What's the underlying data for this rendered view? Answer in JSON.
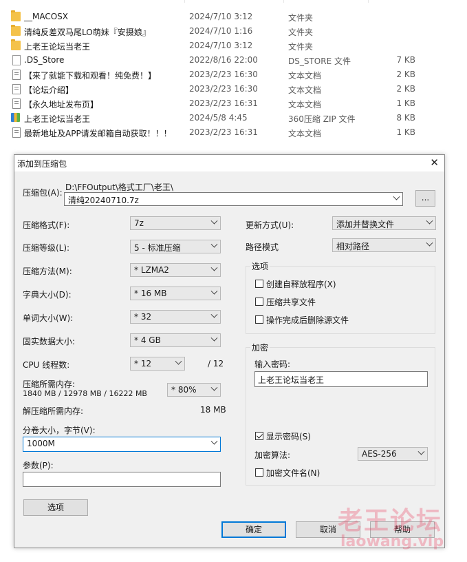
{
  "files": [
    {
      "name": "__MACOSX",
      "date": "2024/7/10 3:12",
      "type": "文件夹",
      "size": "",
      "icon": "folder-icon"
    },
    {
      "name": "清纯反差双马尾LO萌妹『安摄娘』",
      "date": "2024/7/10 1:16",
      "type": "文件夹",
      "size": "",
      "icon": "folder-icon"
    },
    {
      "name": "上老王论坛当老王",
      "date": "2024/7/10 3:12",
      "type": "文件夹",
      "size": "",
      "icon": "folder-icon"
    },
    {
      "name": ".DS_Store",
      "date": "2022/8/16 22:00",
      "type": "DS_STORE 文件",
      "size": "7 KB",
      "icon": "file-icon"
    },
    {
      "name": "【来了就能下载和观看！纯免费！】",
      "date": "2023/2/23 16:30",
      "type": "文本文档",
      "size": "2 KB",
      "icon": "text-file-icon"
    },
    {
      "name": "【论坛介绍】",
      "date": "2023/2/23 16:30",
      "type": "文本文档",
      "size": "2 KB",
      "icon": "text-file-icon"
    },
    {
      "name": "【永久地址发布页】",
      "date": "2023/2/23 16:31",
      "type": "文本文档",
      "size": "1 KB",
      "icon": "text-file-icon"
    },
    {
      "name": "上老王论坛当老王",
      "date": "2024/5/8 4:45",
      "type": "360压缩 ZIP 文件",
      "size": "8 KB",
      "icon": "zip-icon"
    },
    {
      "name": "最新地址及APP请发邮箱自动获取！！！",
      "date": "2023/2/23 16:31",
      "type": "文本文档",
      "size": "1 KB",
      "icon": "text-file-icon"
    }
  ],
  "dialog": {
    "title": "添加到压缩包",
    "archive_label": "压缩包(A):",
    "archive_path": "D:\\FFOutput\\格式工厂\\老王\\",
    "archive_name": "清纯20240710.7z",
    "browse_label": "...",
    "format_label": "压缩格式(F):",
    "format_value": "7z",
    "level_label": "压缩等级(L):",
    "level_value": "5 - 标准压缩",
    "method_label": "压缩方法(M):",
    "method_value": "* LZMA2",
    "dict_label": "字典大小(D):",
    "dict_value": "* 16 MB",
    "word_label": "单词大小(W):",
    "word_value": "* 32",
    "solid_label": "固实数据大小:",
    "solid_value": "* 4 GB",
    "threads_label": "CPU 线程数:",
    "threads_value": "* 12",
    "threads_max": "/ 12",
    "mem_label": "压缩所需内存:",
    "mem_detail": "1840 MB / 12978 MB / 16222 MB",
    "mem_percent": "* 80%",
    "decomp_label": "解压缩所需内存:",
    "decomp_value": "18 MB",
    "split_label": "分卷大小，字节(V):",
    "split_value": "1000M",
    "params_label": "参数(P):",
    "params_value": "",
    "options_button": "选项",
    "update_label": "更新方式(U):",
    "update_value": "添加并替换文件",
    "path_label": "路径模式",
    "path_value": "相对路径",
    "options_group": "选项",
    "opt_sfx": "创建自释放程序(X)",
    "opt_shared": "压缩共享文件",
    "opt_delete": "操作完成后删除源文件",
    "encrypt_group": "加密",
    "password_label": "输入密码:",
    "password_value": "上老王论坛当老王",
    "show_password": "显示密码(S)",
    "enc_method_label": "加密算法:",
    "enc_method_value": "AES-256",
    "encrypt_names": "加密文件名(N)",
    "ok": "确定",
    "cancel": "取消",
    "help": "帮助"
  },
  "watermark": {
    "line1": "老王论坛",
    "line2": "laowang.vip"
  }
}
